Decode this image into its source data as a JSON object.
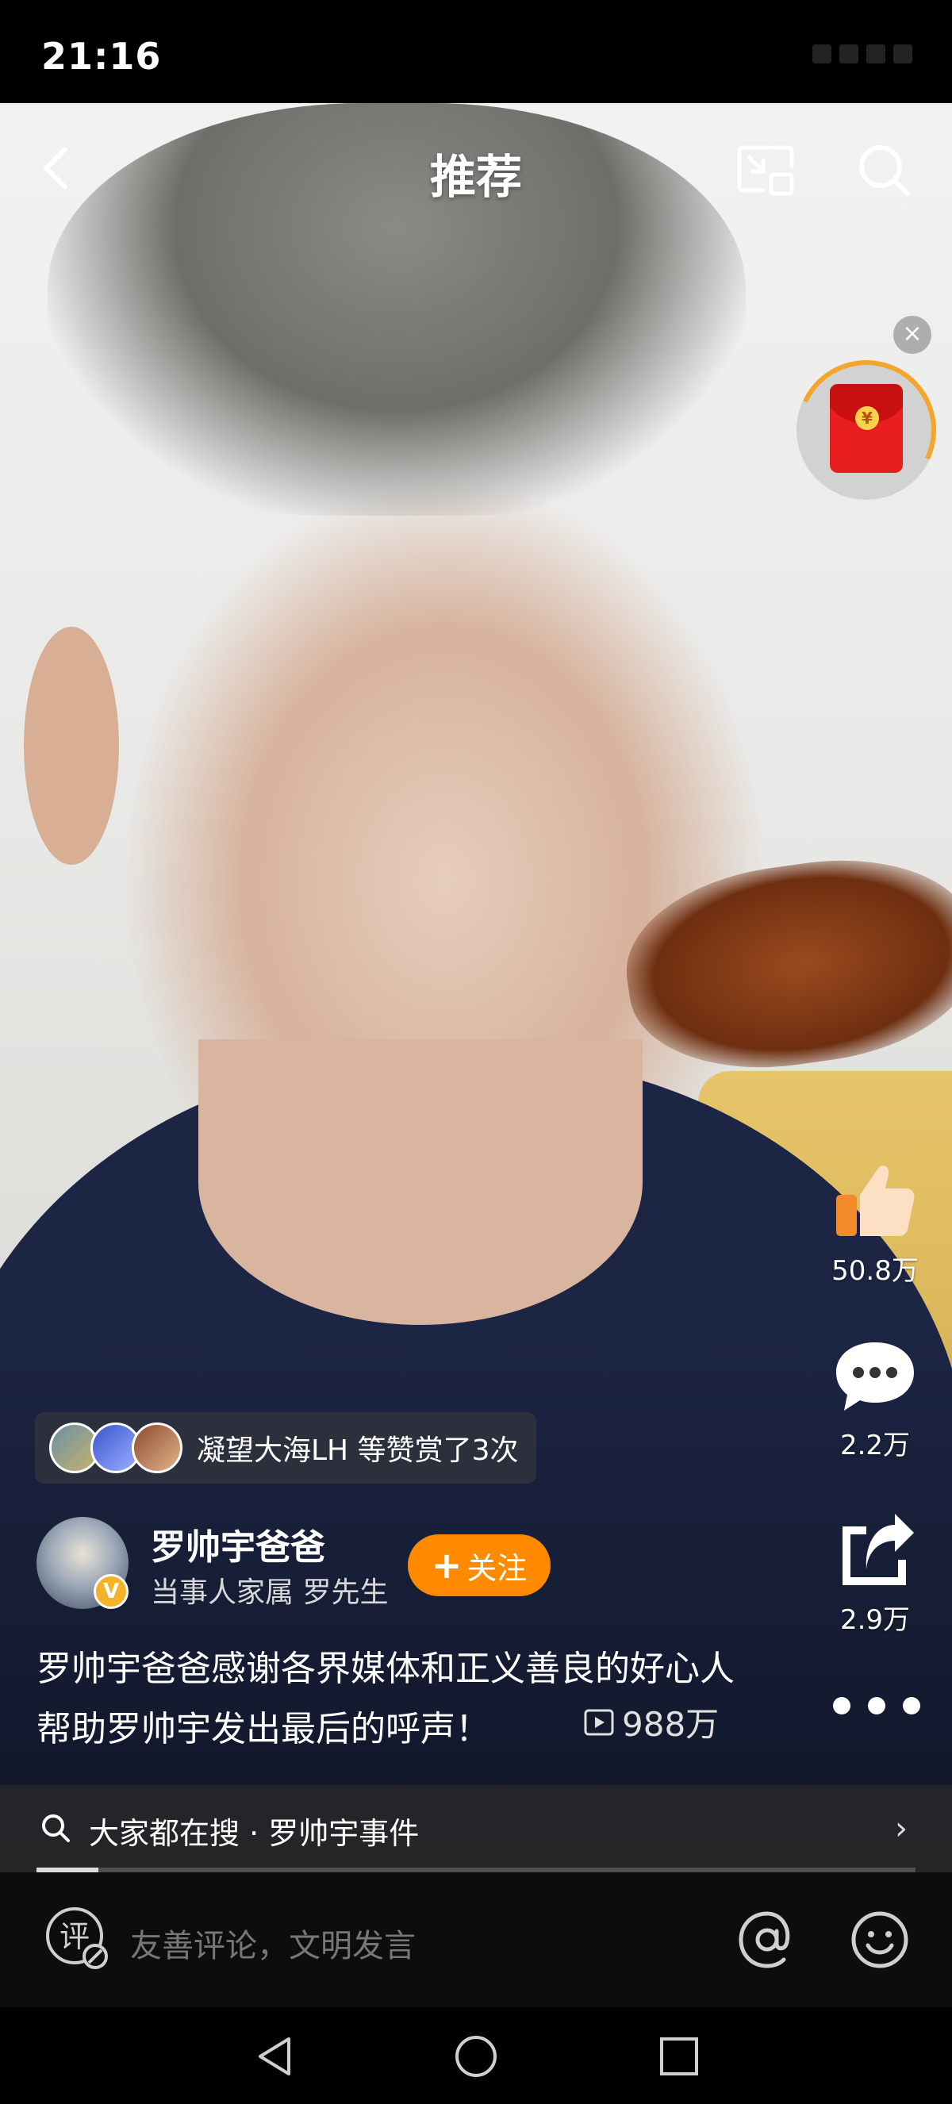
{
  "status_bar": {
    "time": "21:16"
  },
  "header": {
    "title": "推荐"
  },
  "reward": {
    "text": "凝望大海LH 等赞赏了3次"
  },
  "author": {
    "name": "罗帅宇爸爸",
    "subtitle": "当事人家属 罗先生",
    "badge": "V",
    "follow_label": "关注"
  },
  "caption": {
    "text": "罗帅宇爸爸感谢各界媒体和正义善良的好心人帮助罗帅宇发出最后的呼声！",
    "views": "988万"
  },
  "actions": {
    "likes": "50.8万",
    "comments": "2.2万",
    "shares": "2.9万"
  },
  "search_suggestion": {
    "text": "大家都在搜 · 罗帅宇事件",
    "progress": 0.07
  },
  "comment_input": {
    "placeholder": "友善评论，文明发言"
  },
  "colors": {
    "follow": "#ff8a00",
    "packet": "#e81e1e",
    "badge": "#f4b12a"
  }
}
